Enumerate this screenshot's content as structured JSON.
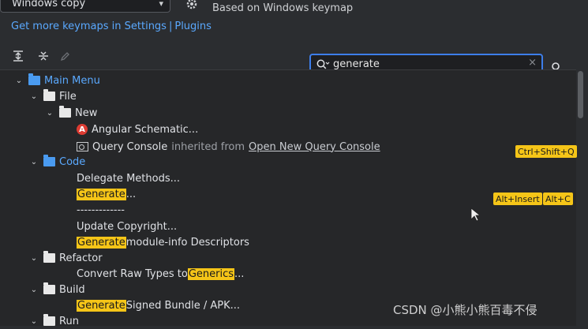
{
  "keymap": {
    "selected": "Windows copy",
    "based_on": "Based on Windows keymap",
    "links": [
      "Get more keymaps in Settings",
      "Plugins"
    ],
    "links_separator": "|"
  },
  "toolbar": {
    "icons": [
      "expand-all-icon",
      "collapse-all-icon",
      "edit-icon"
    ]
  },
  "search": {
    "value": "generate",
    "clear_glyph": "×"
  },
  "tree": {
    "main_menu": "Main Menu",
    "file": "File",
    "new": "New",
    "angular": "Angular Schematic...",
    "query_console": "Query Console",
    "inherited_from": "inherited from",
    "open_new_query_console": "Open New Query Console",
    "query_shortcut": "Ctrl+Shift+Q",
    "code": "Code",
    "delegate_methods": "Delegate Methods...",
    "generate_hl": "Generate",
    "generate_rest": "...",
    "generate_shortcut_1": "Alt+Insert",
    "generate_shortcut_2": "Alt+C",
    "separator": "-------------",
    "update_copyright": "Update Copyright...",
    "gen_module_hl": "Generate",
    "gen_module_rest": " module-info Descriptors",
    "refactor": "Refactor",
    "convert_raw_prefix": "Convert Raw Types to ",
    "convert_raw_hl": "Generics",
    "convert_raw_suffix": "...",
    "build": "Build",
    "gen_signed_hl": "Generate",
    "gen_signed_rest": " Signed Bundle / APK...",
    "run": "Run"
  },
  "watermark": "CSDN @小熊小熊百毒不侵",
  "colors": {
    "highlight": "#f5c518",
    "link_blue": "#5aa9ff",
    "focus_border": "#3d7eea"
  }
}
